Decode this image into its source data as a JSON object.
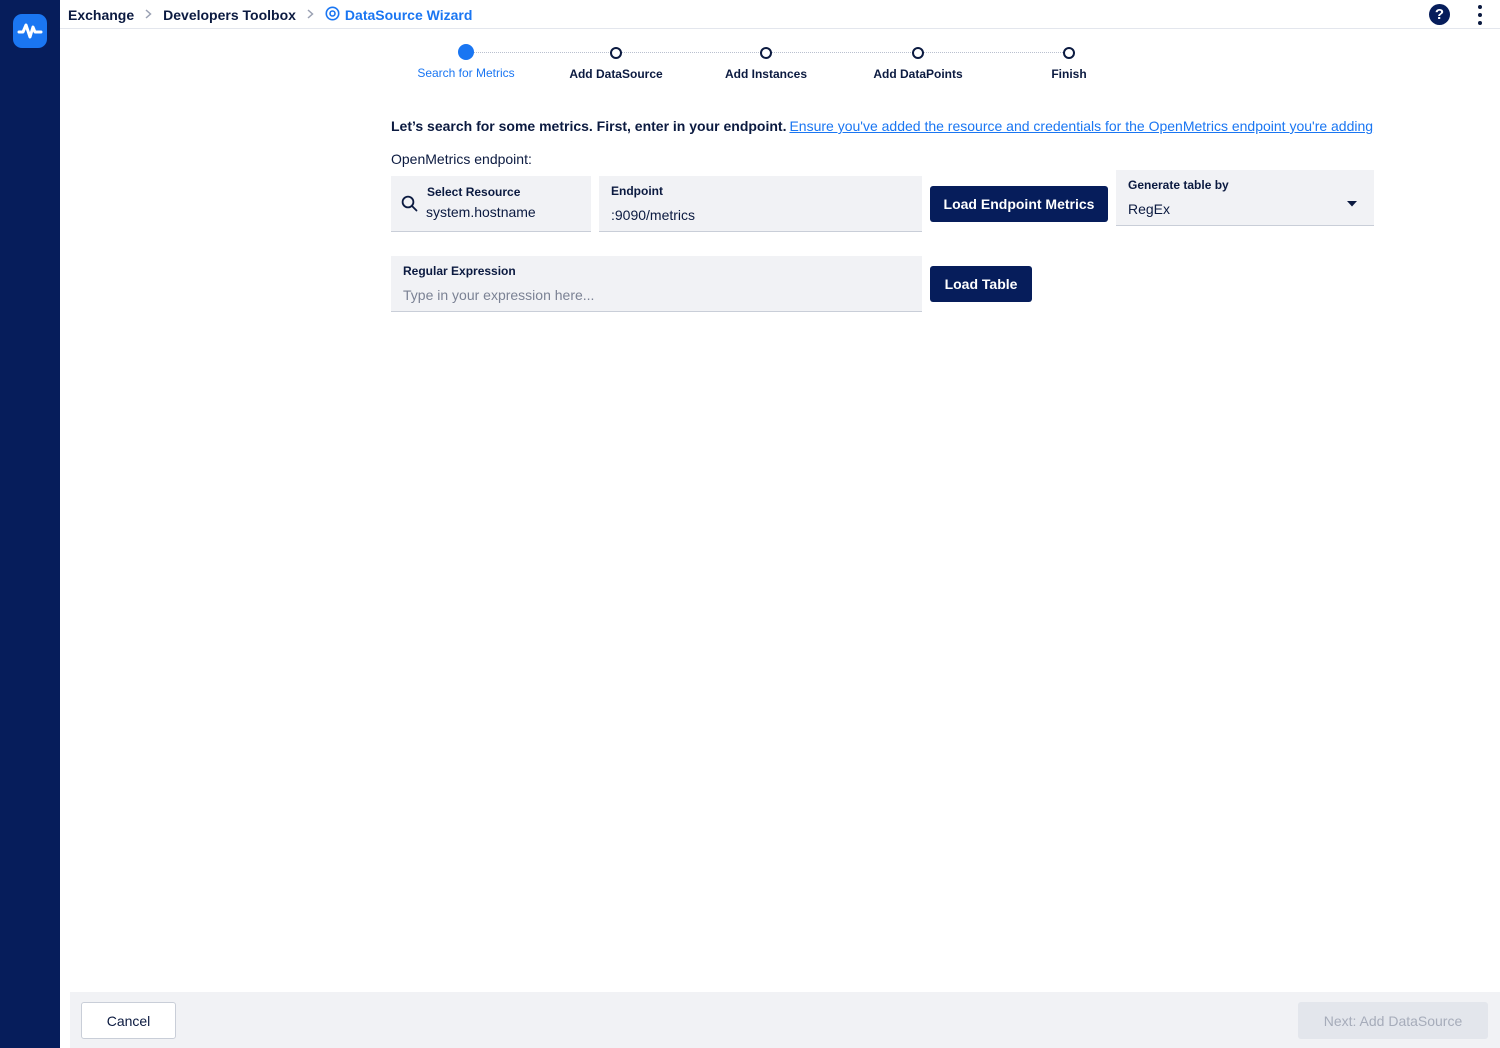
{
  "breadcrumb": {
    "items": [
      "Exchange",
      "Developers Toolbox"
    ],
    "current": "DataSource Wizard"
  },
  "header": {
    "help_icon": "?"
  },
  "colors": {
    "brand": "#061d5b",
    "accent": "#1a76f2"
  },
  "icons": {
    "logo": "logomark-icon",
    "separator": "chevron-right-icon",
    "current": "target-icon",
    "help": "help-icon",
    "menu": "kebab-menu-icon",
    "search": "search-icon",
    "dropdown": "caret-down-icon"
  },
  "stepper": {
    "steps": [
      {
        "label": "Search for Metrics",
        "active": true
      },
      {
        "label": "Add DataSource",
        "active": false
      },
      {
        "label": "Add Instances",
        "active": false
      },
      {
        "label": "Add DataPoints",
        "active": false
      },
      {
        "label": "Finish",
        "active": false
      }
    ]
  },
  "intro": {
    "text": "Let’s search for some metrics. First, enter in your endpoint.",
    "link": "Ensure you've added the resource and credentials for the OpenMetrics endpoint you're adding"
  },
  "form": {
    "section_label": "OpenMetrics endpoint:",
    "resource": {
      "label": "Select Resource",
      "value": "system.hostname"
    },
    "endpoint": {
      "label": "Endpoint",
      "value": ":9090/metrics"
    },
    "load_metrics_button": "Load Endpoint Metrics",
    "generate_by": {
      "label": "Generate table by",
      "value": "RegEx"
    },
    "regex": {
      "label": "Regular Expression",
      "placeholder": "Type in your expression here..."
    },
    "load_table_button": "Load Table"
  },
  "footer": {
    "cancel": "Cancel",
    "next": "Next: Add DataSource"
  }
}
